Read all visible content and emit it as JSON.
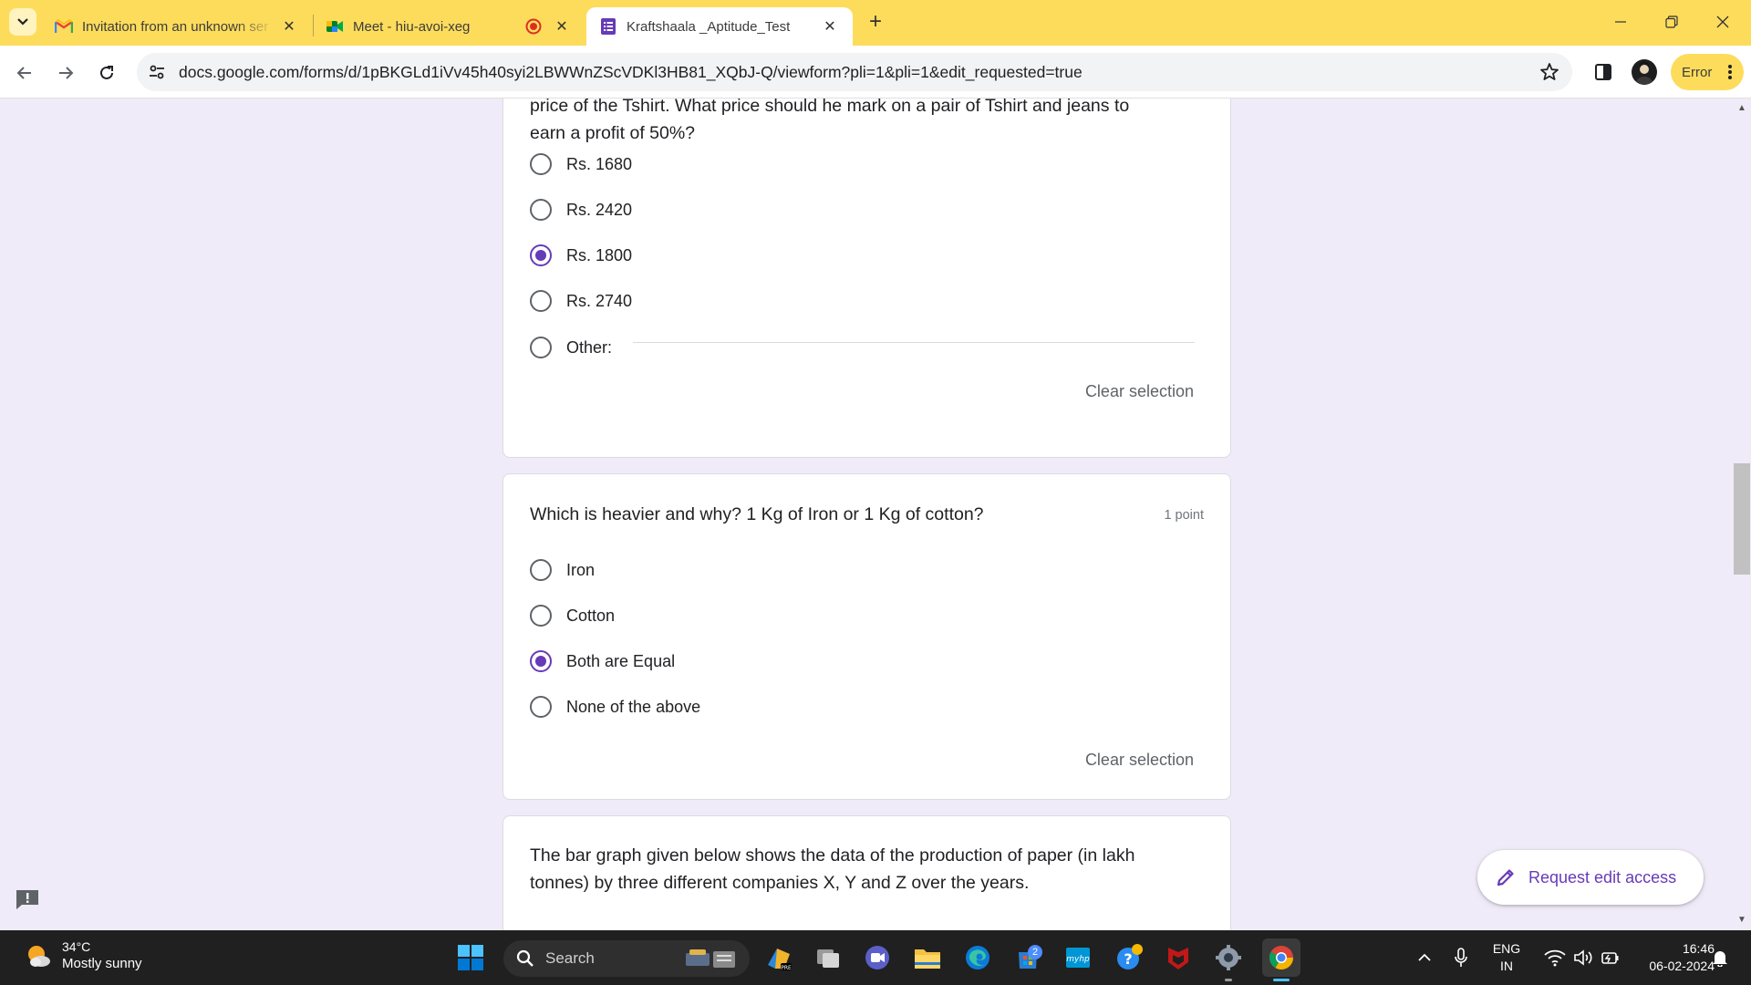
{
  "browser": {
    "tabs": [
      {
        "title": "Invitation from an unknown ser",
        "icon": "gmail-icon"
      },
      {
        "title": "Meet - hiu-avoi-xeg",
        "icon": "meet-icon",
        "recording": true
      },
      {
        "title": "Kraftshaala _Aptitude_Test",
        "icon": "forms-icon",
        "active": true
      }
    ],
    "url": "docs.google.com/forms/d/1pBKGLd1iVv45h40syi2LBWWnZScVDKl3HB81_XQbJ-Q/viewform?pli=1&pli=1&edit_requested=true",
    "error_chip": "Error",
    "chrome_color": "#fddc5c"
  },
  "form": {
    "accent_color": "#673ab7",
    "q1": {
      "text_partial": "price of the Tshirt. What price should he mark on a pair of Tshirt and jeans to earn a profit of 50%?",
      "text_line1": "price of the Tshirt. What price should he mark on a pair of Tshirt and jeans to",
      "text_line2": "earn a profit of 50%?",
      "options": [
        "Rs. 1680",
        "Rs. 2420",
        "Rs. 1800",
        "Rs. 2740",
        "Other:"
      ],
      "selected": "Rs. 1800",
      "clear": "Clear selection"
    },
    "q2": {
      "text": "Which is heavier and why? 1 Kg of Iron or 1 Kg of cotton?",
      "points": "1 point",
      "options": [
        "Iron",
        "Cotton",
        "Both are Equal",
        "None of the above"
      ],
      "selected": "Both are Equal",
      "clear": "Clear selection"
    },
    "q3": {
      "text_line1": "The bar graph given below shows the data of the production of paper (in lakh",
      "text_line2": "tonnes) by three different companies X, Y and Z over the years."
    },
    "request_edit": "Request edit access"
  },
  "taskbar": {
    "weather_temp": "34°C",
    "weather_condition": "Mostly sunny",
    "search_label": "Search",
    "store_badge": "2",
    "language_line1": "ENG",
    "language_line2": "IN",
    "time": "16:46",
    "date": "06-02-2024"
  }
}
